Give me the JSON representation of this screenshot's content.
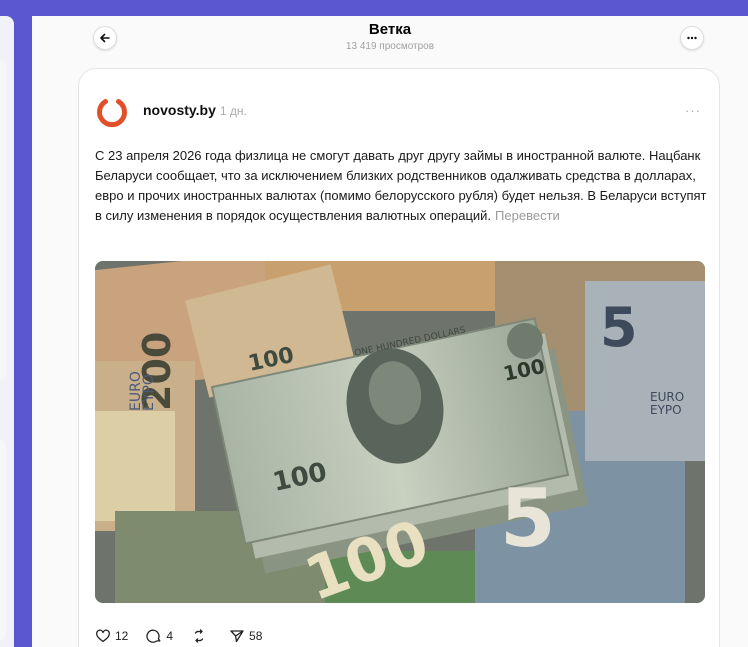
{
  "header": {
    "title": "Ветка",
    "views": "13 419 просмотров"
  },
  "post": {
    "author": "novosty.by",
    "time": "1 дн.",
    "text": "С 23 апреля 2026 года физлица не смогут давать друг другу займы в иностранной валюте. Нацбанк Беларуси сообщает, что за исключением близких родственников одалживать средства в долларах, евро и прочих иностранных валютах (помимо белорусского рубля) будет нельзя. В Беларуси вступят в силу изменения в порядок осуществления валютных операций.",
    "translate_label": "Перевести",
    "image_lettering": [
      "100",
      "EURO",
      "EYPO",
      "200",
      "5",
      "ONE HUNDRED DOLLARS"
    ]
  },
  "actions": {
    "likes": "12",
    "comments": "4",
    "shares": "58"
  },
  "icons": {
    "back": "arrow-left-icon",
    "more": "ellipsis-icon",
    "like": "heart-icon",
    "comment": "speech-bubble-icon",
    "repost": "repost-icon",
    "share": "send-icon"
  },
  "colors": {
    "background": "#5b57d0",
    "logo": "#e2502a"
  }
}
